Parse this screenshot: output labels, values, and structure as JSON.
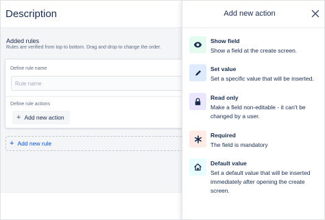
{
  "editor": {
    "title": "Description",
    "added_rules_title": "Added rules",
    "added_rules_desc": "Rules are verified from top to bottom. Drag and drop to change the order.",
    "rule_name_label": "Define rule name",
    "rule_name_placeholder": "Rule name",
    "rule_name_value": "",
    "rule_actions_label": "Define rule actions",
    "add_action_label": "Add new action",
    "add_rule_label": "Add new rule"
  },
  "drawer": {
    "title": "Add new action",
    "options": [
      {
        "title": "Show field",
        "desc": "Show a field at the create screen.",
        "icon": "eye-icon",
        "bg": "#e3fcef",
        "fg": "#172b4d"
      },
      {
        "title": "Set value",
        "desc": "Set a specific value that will be inserted.",
        "icon": "pencil-icon",
        "bg": "#deebff",
        "fg": "#172b4d"
      },
      {
        "title": "Read only",
        "desc": "Make a field non-editable - it can't be changed by a user.",
        "icon": "lock-icon",
        "bg": "#eae6ff",
        "fg": "#172b4d"
      },
      {
        "title": "Required",
        "desc": "The field is mandatory",
        "icon": "asterisk-icon",
        "bg": "#ffebe6",
        "fg": "#172b4d"
      },
      {
        "title": "Default value",
        "desc": "Set a default value that will be inserted immediately after opening the create screen.",
        "icon": "home-icon",
        "bg": "#e6fcff",
        "fg": "#172b4d"
      }
    ]
  }
}
